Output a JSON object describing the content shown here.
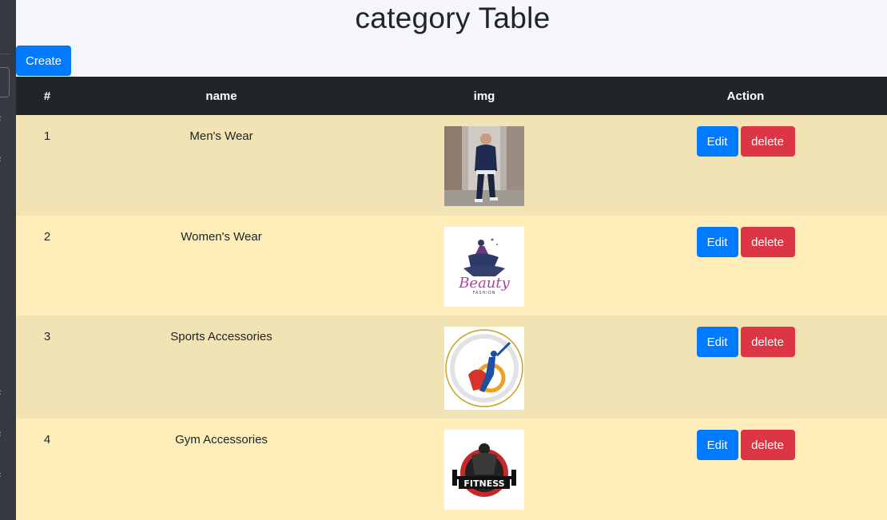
{
  "page": {
    "title": "category Table",
    "create_label": "Create"
  },
  "table": {
    "headers": [
      "#",
      "name",
      "img",
      "Action"
    ],
    "rows": [
      {
        "num": "1",
        "name": "Men's Wear",
        "img": "mens-wear-photo",
        "edit": "Edit",
        "delete": "delete"
      },
      {
        "num": "2",
        "name": "Women's Wear",
        "img": "beauty-fashion-logo",
        "edit": "Edit",
        "delete": "delete"
      },
      {
        "num": "3",
        "name": "Sports Accessories",
        "img": "cricket-association-logo",
        "edit": "Edit",
        "delete": "delete"
      },
      {
        "num": "4",
        "name": "Gym Accessories",
        "img": "fitness-logo",
        "edit": "Edit",
        "delete": "delete"
      }
    ]
  },
  "logos": {
    "beauty_text": "Beauty",
    "beauty_sub": "FASHION",
    "fitness_text": "FITNESS"
  },
  "colors": {
    "primary": "#007bff",
    "danger": "#dc3545",
    "header_bg": "#212529",
    "row_odd": "#f2e3b4",
    "row_even": "#ffeeb9"
  }
}
